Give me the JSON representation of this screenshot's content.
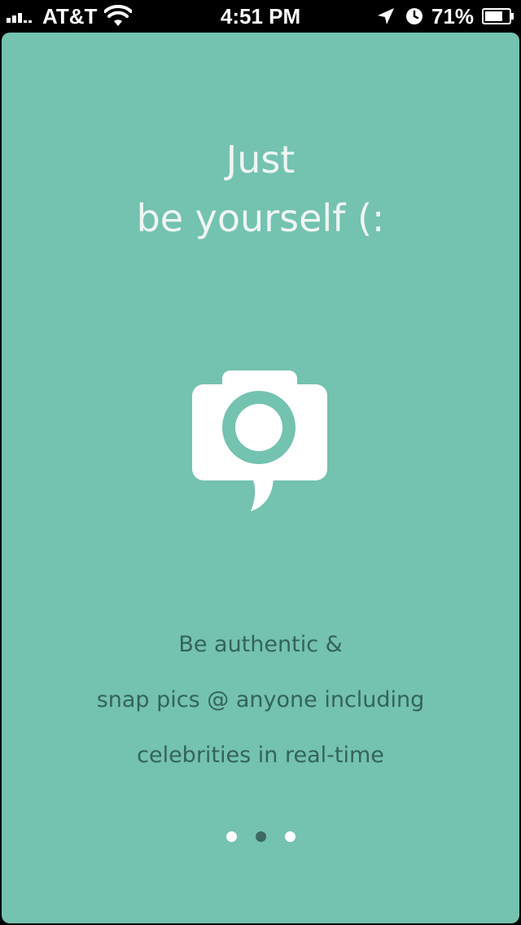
{
  "status_bar": {
    "carrier": "AT&T",
    "time": "4:51 PM",
    "battery_percent": "71%",
    "icons": [
      "signal-icon",
      "wifi-icon",
      "location-icon",
      "alarm-icon",
      "battery-icon"
    ]
  },
  "onboarding": {
    "headline_lines": [
      "Just",
      "be yourself (:"
    ],
    "logo_icon": "camera-speech-bubble-icon",
    "description_lines": [
      "Be authentic &",
      "snap pics @ anyone including",
      "celebrities in real-time"
    ],
    "pager": {
      "total_pages": 3,
      "current_page": 2
    }
  },
  "colors": {
    "background": "#74c2b0",
    "headline_text": "#eef5f2",
    "description_text": "#33645b",
    "dot_active": "#3a6a60",
    "dot_inactive": "#ffffff",
    "logo": "#ffffff"
  }
}
